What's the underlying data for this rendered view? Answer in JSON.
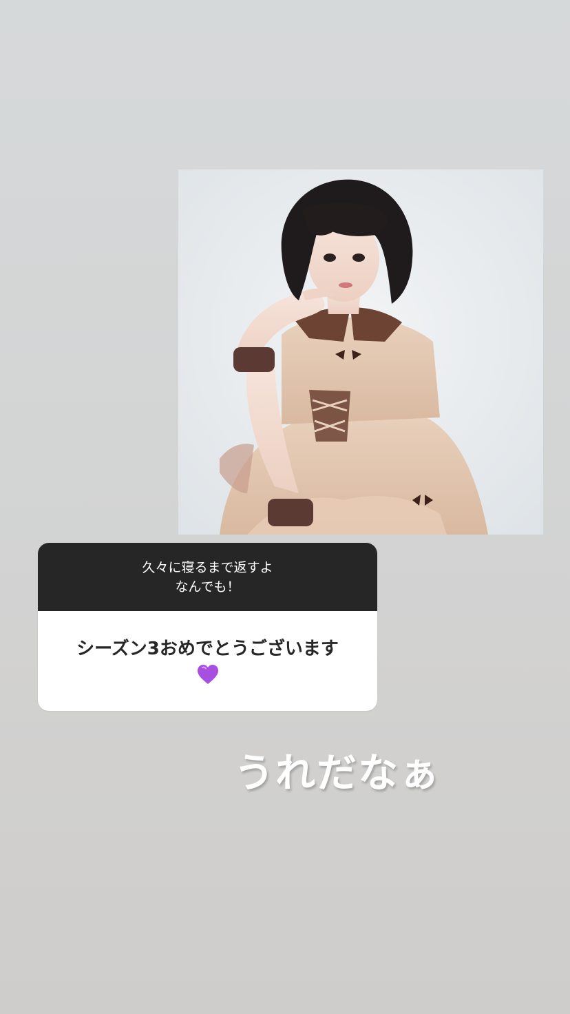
{
  "story": {
    "photo": {
      "alt_semantic": "portrait-photo"
    },
    "question_sticker": {
      "prompt_line_1": "久々に寝るまで返すよ",
      "prompt_line_2": "なんでも！",
      "answer_text": "シーズン3おめでとうございます",
      "answer_emoji": "purple-heart-icon",
      "header_color": "#262626",
      "body_color": "#ffffff"
    },
    "overlay_text": "うれだなぁ",
    "colors": {
      "background_top": "#d6d9da",
      "background_bottom": "#cfcdcb",
      "heart": "#a64fe0"
    }
  }
}
